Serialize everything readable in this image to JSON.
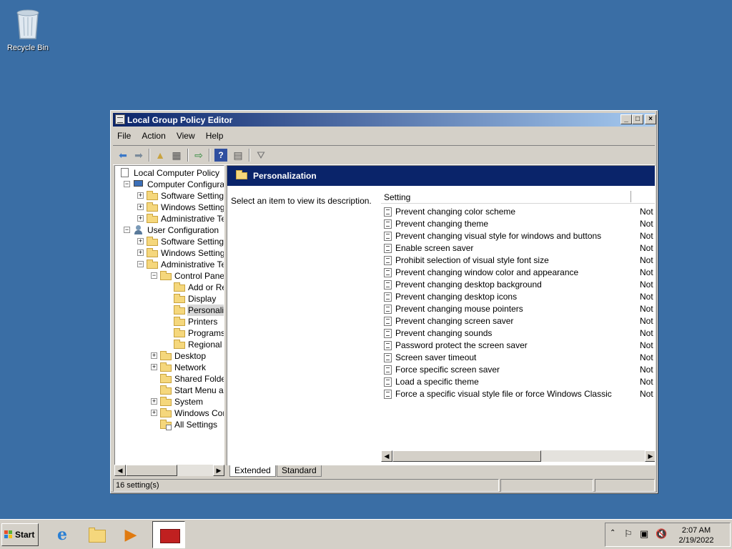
{
  "desktop": {
    "recycle_bin_label": "Recycle Bin"
  },
  "window": {
    "title": "Local Group Policy Editor",
    "controls": {
      "minimize": "_",
      "maximize": "□",
      "close": "×"
    },
    "menu": [
      "File",
      "Action",
      "View",
      "Help"
    ]
  },
  "tree": [
    {
      "label": "Local Computer Policy"
    },
    {
      "label": "Computer Configuration",
      "expander": "−"
    },
    {
      "label": "Software Settings",
      "expander": "+"
    },
    {
      "label": "Windows Settings",
      "expander": "+"
    },
    {
      "label": "Administrative Templates",
      "expander": "+"
    },
    {
      "label": "User Configuration",
      "expander": "−"
    },
    {
      "label": "Software Settings",
      "expander": "+"
    },
    {
      "label": "Windows Settings",
      "expander": "+"
    },
    {
      "label": "Administrative Templates",
      "expander": "−"
    },
    {
      "label": "Control Panel",
      "expander": "−"
    },
    {
      "label": "Add or Remove Programs"
    },
    {
      "label": "Display"
    },
    {
      "label": "Personalization",
      "selected": true
    },
    {
      "label": "Printers"
    },
    {
      "label": "Programs"
    },
    {
      "label": "Regional and Language Options"
    },
    {
      "label": "Desktop",
      "expander": "+"
    },
    {
      "label": "Network",
      "expander": "+"
    },
    {
      "label": "Shared Folders"
    },
    {
      "label": "Start Menu and Taskbar"
    },
    {
      "label": "System",
      "expander": "+"
    },
    {
      "label": "Windows Components",
      "expander": "+"
    },
    {
      "label": "All Settings"
    }
  ],
  "details": {
    "heading": "Personalization",
    "description": "Select an item to view its description.",
    "column_setting": "Setting",
    "settings": [
      {
        "name": "Prevent changing color scheme",
        "state": "Not configured"
      },
      {
        "name": "Prevent changing theme",
        "state": "Not configured"
      },
      {
        "name": "Prevent changing visual style for windows and buttons",
        "state": "Not configured"
      },
      {
        "name": "Enable screen saver",
        "state": "Not configured"
      },
      {
        "name": "Prohibit selection of visual style font size",
        "state": "Not configured"
      },
      {
        "name": "Prevent changing window color and appearance",
        "state": "Not configured"
      },
      {
        "name": "Prevent changing desktop background",
        "state": "Not configured"
      },
      {
        "name": "Prevent changing desktop icons",
        "state": "Not configured"
      },
      {
        "name": "Prevent changing mouse pointers",
        "state": "Not configured"
      },
      {
        "name": "Prevent changing screen saver",
        "state": "Not configured"
      },
      {
        "name": "Prevent changing sounds",
        "state": "Not configured"
      },
      {
        "name": "Password protect the screen saver",
        "state": "Not configured"
      },
      {
        "name": "Screen saver timeout",
        "state": "Not configured"
      },
      {
        "name": "Force specific screen saver",
        "state": "Not configured"
      },
      {
        "name": "Load a specific theme",
        "state": "Not configured"
      },
      {
        "name": "Force a specific visual style file or force Windows Classic",
        "state": "Not configured"
      }
    ],
    "tabs": [
      "Extended",
      "Standard"
    ],
    "active_tab": "Extended"
  },
  "status": {
    "text": "16 setting(s)"
  },
  "taskbar": {
    "start_label": "Start",
    "time": "2:07 AM",
    "date": "2/19/2022"
  }
}
